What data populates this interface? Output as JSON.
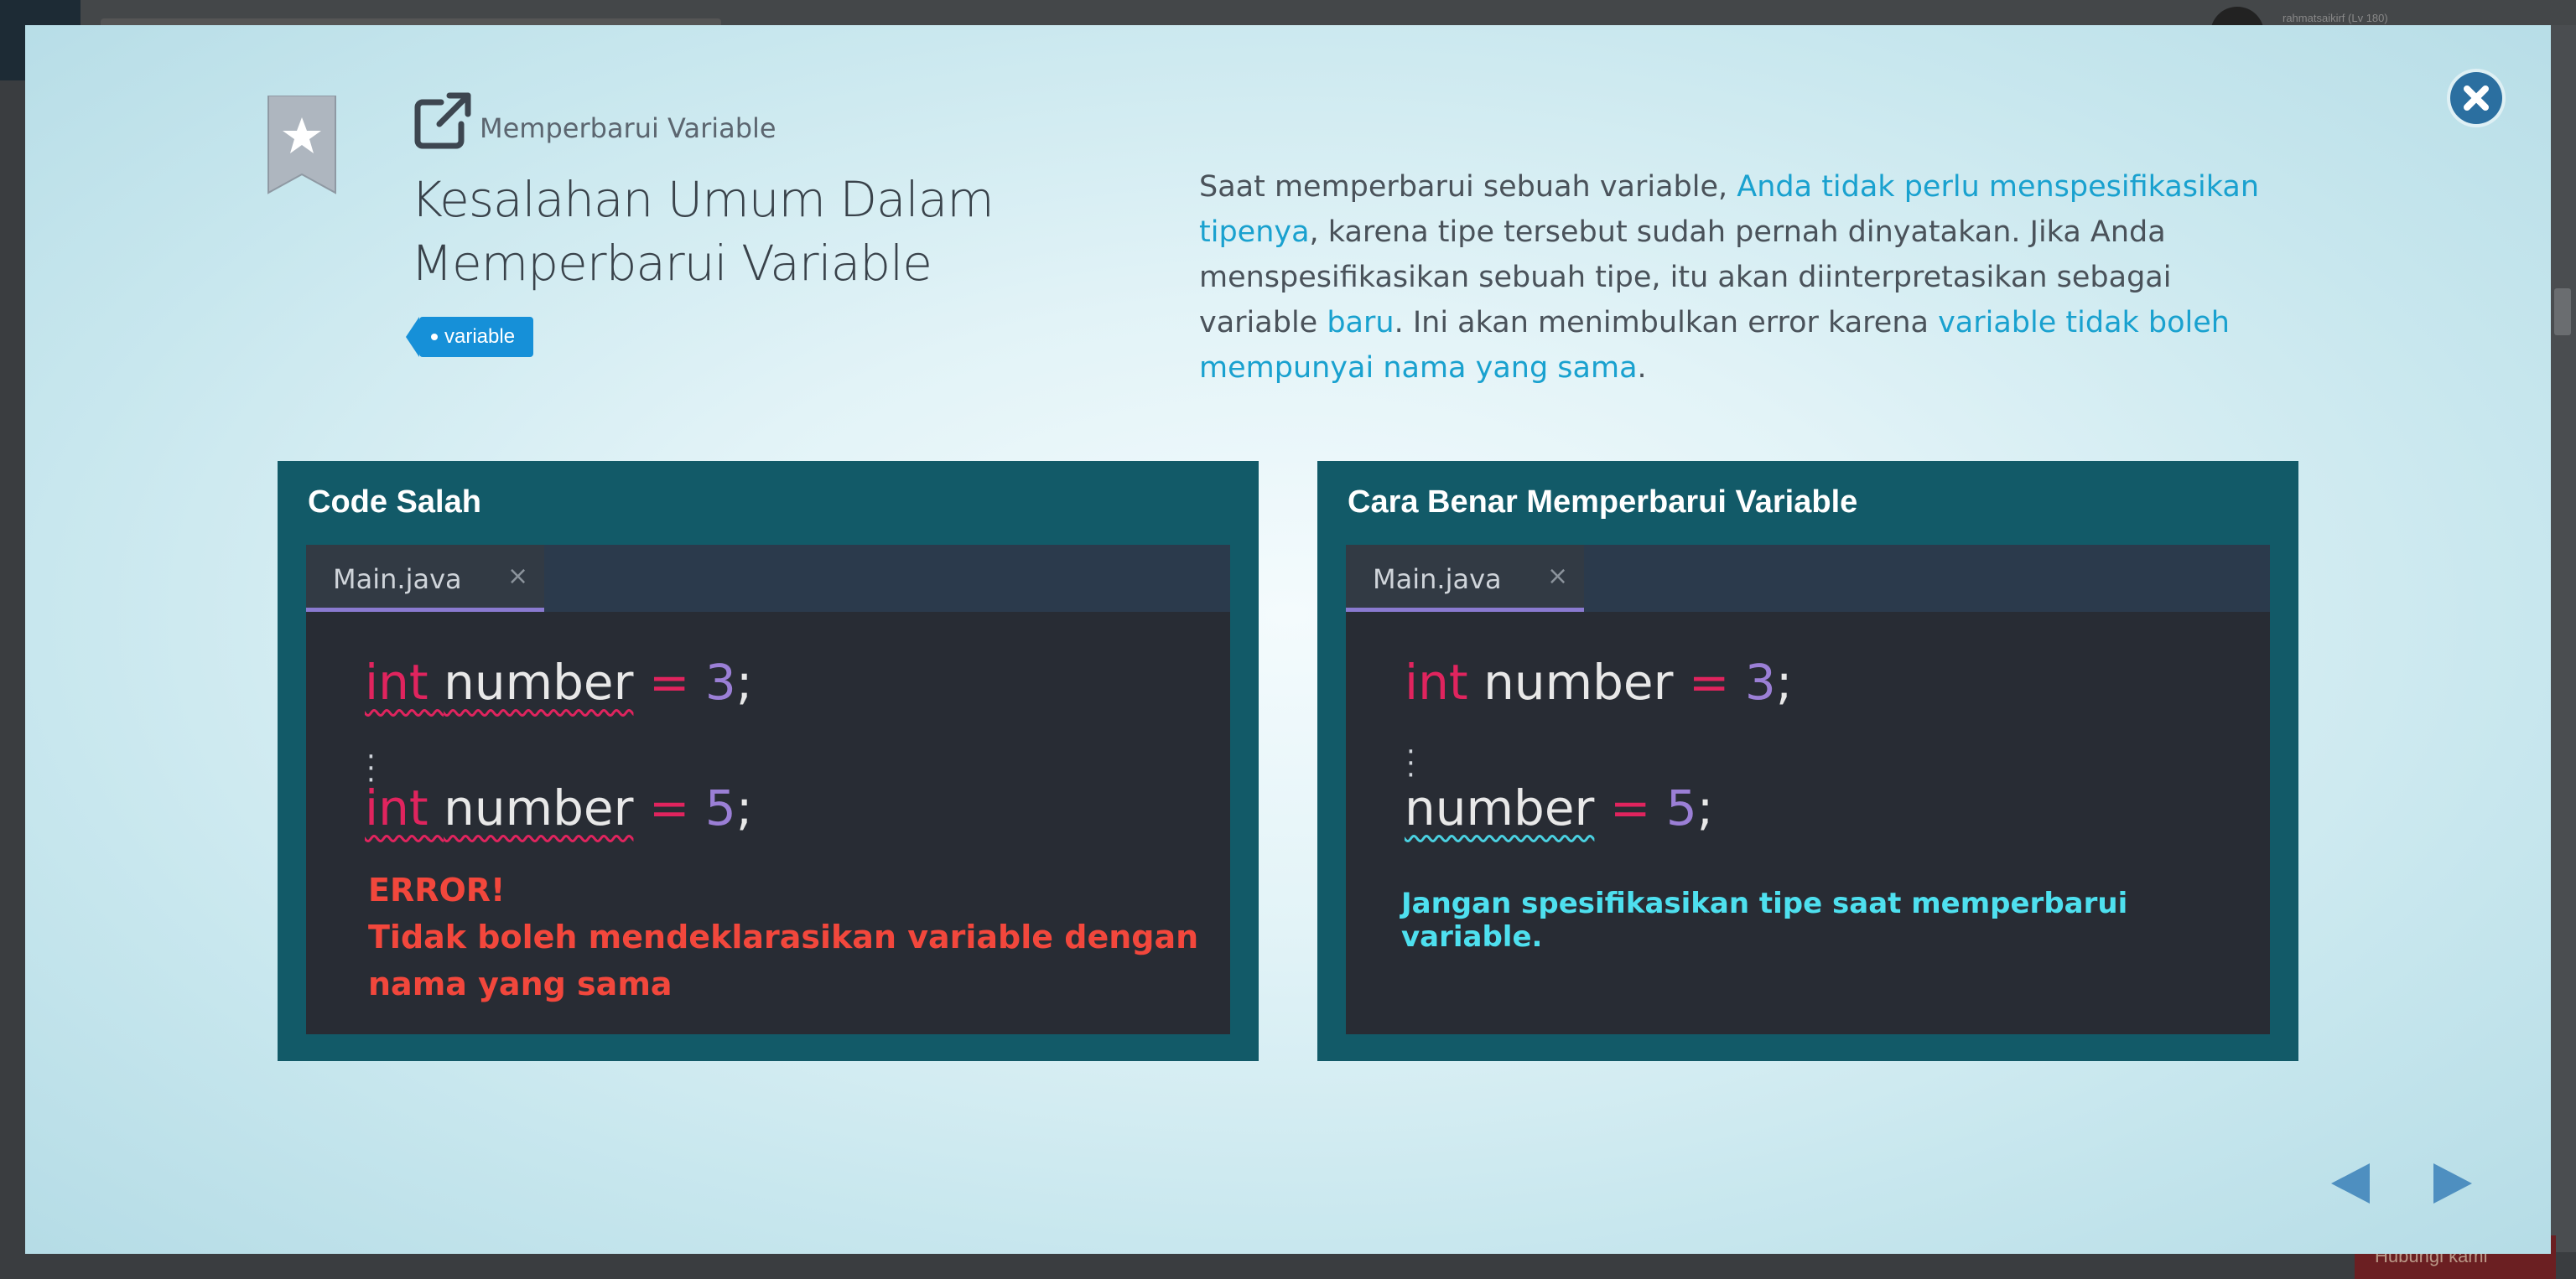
{
  "background": {
    "user_label": "rahmatsaikirf (Lv 180)",
    "bottom_button": "Hubungi kami"
  },
  "modal": {
    "breadcrumb": "Memperbarui Variable",
    "title_line1": "Kesalahan Umum Dalam",
    "title_line2": "Memperbarui Variable",
    "tag": "variable",
    "description": {
      "p1": "Saat memperbarui sebuah variable, ",
      "h1": "Anda tidak perlu menspesifikasikan tipenya",
      "p2": ", karena tipe tersebut sudah pernah dinyatakan. Jika Anda menspesifikasikan sebuah tipe, itu akan diinterpretasikan sebagai variable ",
      "h2": "baru",
      "p3": ". Ini akan menimbulkan error karena ",
      "h3": "variable tidak boleh mempunyai nama yang sama",
      "p4": "."
    },
    "close_icon": "close-circle-icon"
  },
  "panels": {
    "left": {
      "title": "Code Salah",
      "tab": "Main.java",
      "tab_close": "×",
      "line1": {
        "kw": "int",
        "id": "number",
        "eq": "=",
        "num": "3",
        "end": ";"
      },
      "line2": {
        "kw": "int",
        "id": "number",
        "eq": "=",
        "num": "5",
        "end": ";"
      },
      "error_title": "ERROR!",
      "error_line1": "Tidak boleh mendeklarasikan variable dengan",
      "error_line2": "nama yang sama"
    },
    "right": {
      "title": "Cara Benar Memperbarui Variable",
      "tab": "Main.java",
      "tab_close": "×",
      "line1": {
        "kw": "int",
        "id": "number",
        "eq": "=",
        "num": "3",
        "end": ";"
      },
      "line2": {
        "id": "number",
        "eq": "=",
        "num": "5",
        "end": ";"
      },
      "hint": "Jangan spesifikasikan tipe saat memperbarui variable."
    }
  },
  "nav": {
    "prev_icon": "triangle-left-icon",
    "next_icon": "triangle-right-icon"
  },
  "colors": {
    "panel_bg": "#125a68",
    "editor_bg": "#282c34",
    "keyword": "#e0245e",
    "number": "#9b7fd6",
    "error": "#f2473c",
    "hint": "#4ee0ef",
    "link": "#19a1cf",
    "tag": "#1690d8"
  }
}
